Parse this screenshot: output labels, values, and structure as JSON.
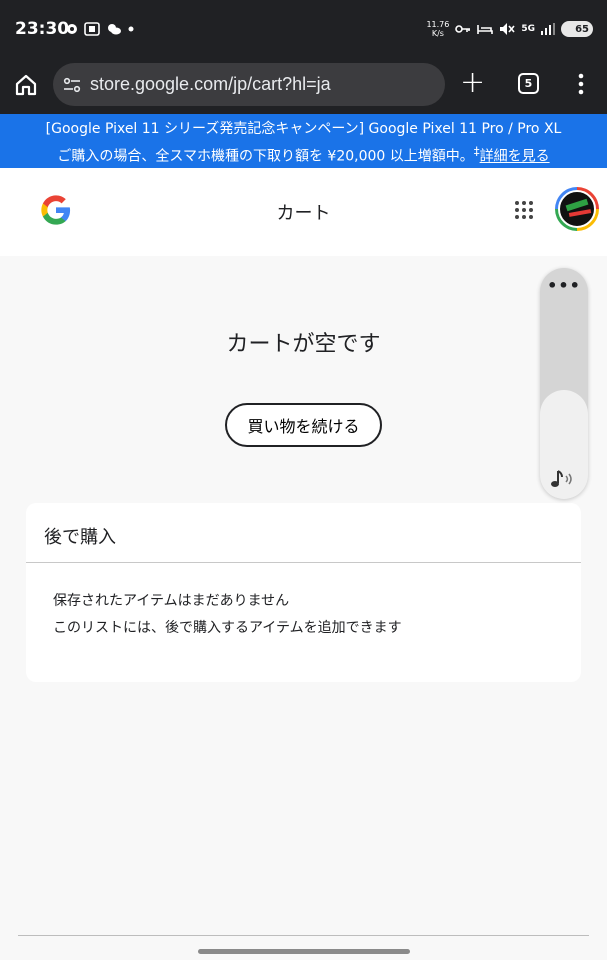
{
  "status_bar": {
    "time": "23:30",
    "left_icons": [
      "notification-icon",
      "screenshot-icon",
      "weather-icon",
      "dot-icon"
    ],
    "speed_value": "11.76",
    "speed_unit": "K/s",
    "network": "5G",
    "battery": "65"
  },
  "browser": {
    "url": "store.google.com/jp/cart?hl=ja",
    "tab_count": "5"
  },
  "promo": {
    "line1": "[Google Pixel 11 シリーズ発売記念キャンペーン] Google Pixel 11 Pro / Pro XL",
    "line2_text": "ご購入の場合、全スマホ機種の下取り額を ¥20,000 以上増額中。",
    "line2_sup": "‡",
    "link": "詳細を見る"
  },
  "header": {
    "title": "カート"
  },
  "cart": {
    "empty_title": "カートが空です",
    "continue_button": "買い物を続ける"
  },
  "later": {
    "title": "後で購入",
    "line1": "保存されたアイテムはまだありません",
    "line2": "このリストには、後で購入するアイテムを追加できます"
  },
  "volume": {
    "menu_label": "•••",
    "level": 0.47
  },
  "colors": {
    "promo_bg": "#1a73e8",
    "chrome_bg": "#202124"
  }
}
